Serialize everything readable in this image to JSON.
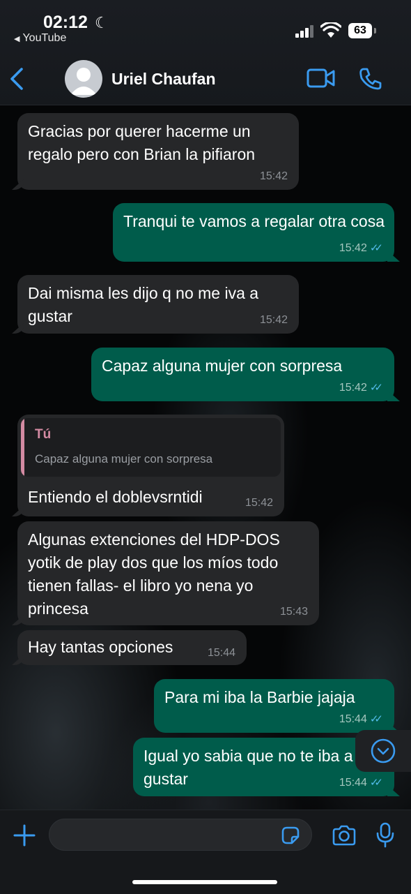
{
  "status_bar": {
    "time": "02:12",
    "back_app": "YouTube",
    "battery": "63"
  },
  "header": {
    "contact_name": "Uriel Chaufan"
  },
  "messages": [
    {
      "direction": "in",
      "text": "Gracias por querer hacerme un regalo pero con Brian la pifiaron",
      "time": "15:42"
    },
    {
      "direction": "out",
      "text": "Tranqui te vamos a regalar otra cosa",
      "time": "15:42",
      "read": true
    },
    {
      "direction": "in",
      "text": "Dai misma les dijo q no me iva a gustar",
      "time": "15:42"
    },
    {
      "direction": "out",
      "text": "Capaz alguna mujer con sorpresa",
      "time": "15:42",
      "read": true
    },
    {
      "direction": "in",
      "text": "Entiendo el doblevsrntidi",
      "time": "15:42",
      "quote": {
        "author": "Tú",
        "text": "Capaz alguna mujer con sorpresa"
      }
    },
    {
      "direction": "in",
      "text": "Algunas extenciones del HDP-DOS yotik de play dos que los míos todo tienen fallas- el libro yo nena yo princesa",
      "time": "15:43"
    },
    {
      "direction": "in",
      "text": "Hay tantas opciones",
      "time": "15:44"
    },
    {
      "direction": "out",
      "text": "Para mi iba la Barbie jajaja",
      "time": "15:44",
      "read": true
    },
    {
      "direction": "out",
      "text": "Igual yo sabia que no te iba a gustar",
      "time": "15:44",
      "read": true
    }
  ],
  "icons": {
    "back": "chevron-left-icon",
    "video": "video-camera-icon",
    "call": "phone-icon",
    "scroll": "chevron-down-icon",
    "attach": "plus-icon",
    "sticker": "sticker-icon",
    "camera": "camera-icon",
    "mic": "microphone-icon"
  },
  "colors": {
    "accent": "#3a9bf0",
    "incoming_bubble": "#262729",
    "outgoing_bubble": "#005c4b",
    "read_ticks": "#53bdeb",
    "quote_author": "#d48ba3"
  }
}
